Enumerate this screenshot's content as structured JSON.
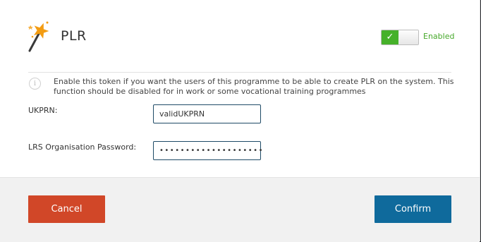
{
  "dialog": {
    "title": "PLR",
    "toggle": {
      "state_label": "Enabled",
      "check_glyph": "✓",
      "enabled": true,
      "on_color": "#46b12a"
    },
    "info": {
      "icon": "info-icon",
      "text": "Enable this token if you want the users of this programme to be able to create PLR on the system. This function should be disabled for in work or some vocational training programmes"
    },
    "fields": {
      "ukprn": {
        "label": "UKPRN:",
        "value": "validUKPRN"
      },
      "password": {
        "label": "LRS Organisation Password:",
        "value": "••••••••••••••••••••"
      }
    },
    "buttons": {
      "cancel": {
        "label": "Cancel",
        "color": "#d14728"
      },
      "confirm": {
        "label": "Confirm",
        "color": "#0f6a9c"
      }
    }
  }
}
